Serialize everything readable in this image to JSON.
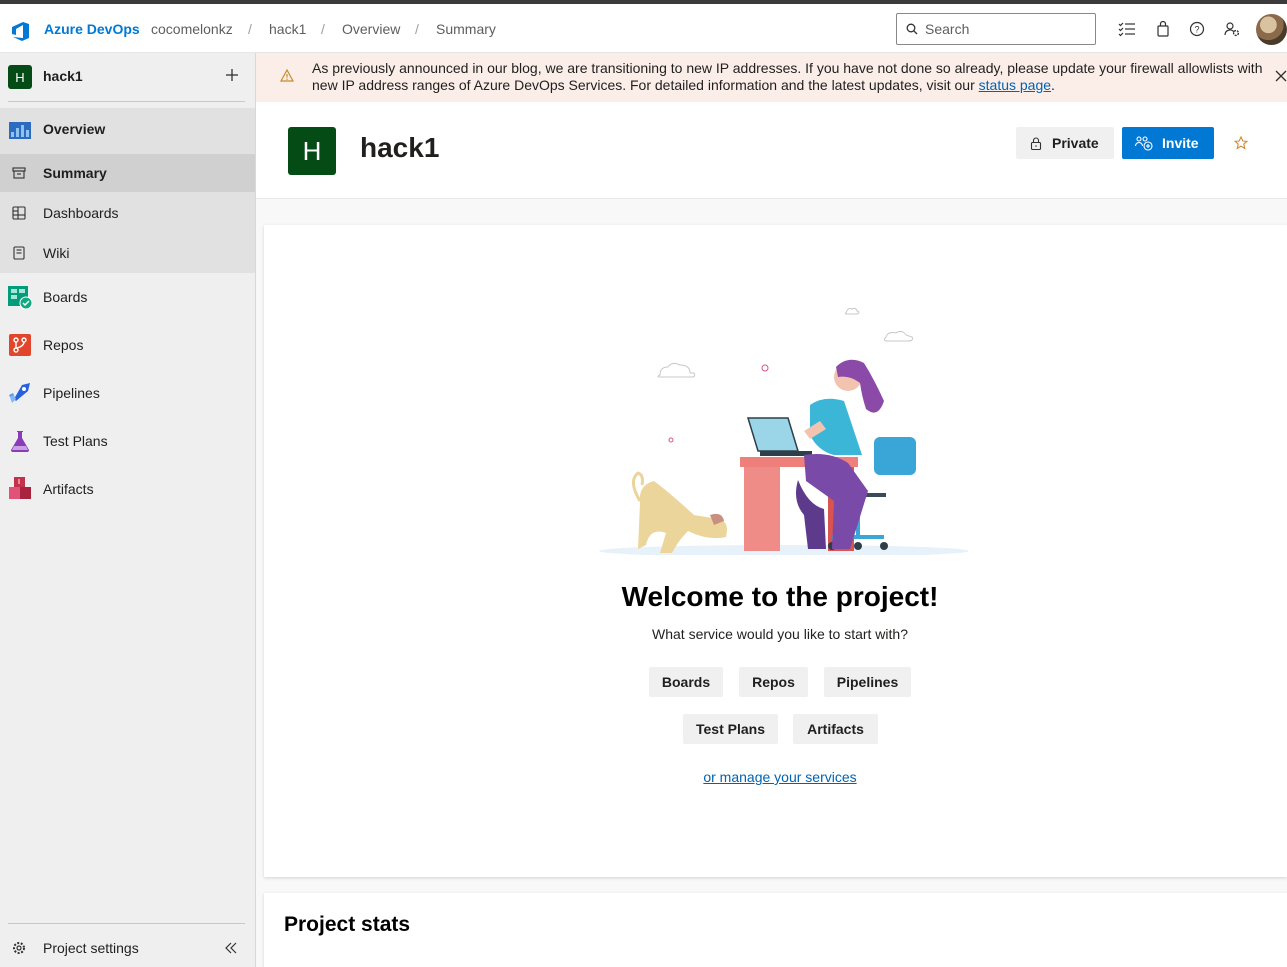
{
  "header": {
    "brand": "Azure DevOps",
    "breadcrumbs": [
      "cocomelonkz",
      "hack1",
      "Overview",
      "Summary"
    ],
    "search_placeholder": "Search"
  },
  "sidebar": {
    "project_initial": "H",
    "project_name": "hack1",
    "items": [
      {
        "label": "Overview",
        "icon": "overview-icon",
        "bold": true
      },
      {
        "label": "Summary",
        "icon": "summary-icon",
        "bold": true,
        "selected": true
      },
      {
        "label": "Dashboards",
        "icon": "dashboards-icon"
      },
      {
        "label": "Wiki",
        "icon": "wiki-icon"
      },
      {
        "label": "Boards",
        "icon": "boards-icon"
      },
      {
        "label": "Repos",
        "icon": "repos-icon"
      },
      {
        "label": "Pipelines",
        "icon": "pipelines-icon"
      },
      {
        "label": "Test Plans",
        "icon": "test-plans-icon"
      },
      {
        "label": "Artifacts",
        "icon": "artifacts-icon"
      }
    ],
    "settings_label": "Project settings"
  },
  "banner": {
    "text": "As previously announced in our blog, we are transitioning to new IP addresses. If you have not done so already, please update your firewall allowlists with new IP address ranges of Azure DevOps Services. For detailed information and the latest updates, visit our ",
    "link": "status page",
    "suffix": "."
  },
  "project": {
    "initial": "H",
    "title": "hack1",
    "private_label": "Private",
    "invite_label": "Invite"
  },
  "welcome": {
    "title": "Welcome to the project!",
    "question": "What service would you like to start with?",
    "services": [
      "Boards",
      "Repos",
      "Pipelines",
      "Test Plans",
      "Artifacts"
    ],
    "manage_link": "or manage your services"
  },
  "stats": {
    "title": "Project stats"
  },
  "colors": {
    "accent": "#0078d4",
    "project_tile": "#054b16",
    "banner_bg": "#fbeee9"
  }
}
